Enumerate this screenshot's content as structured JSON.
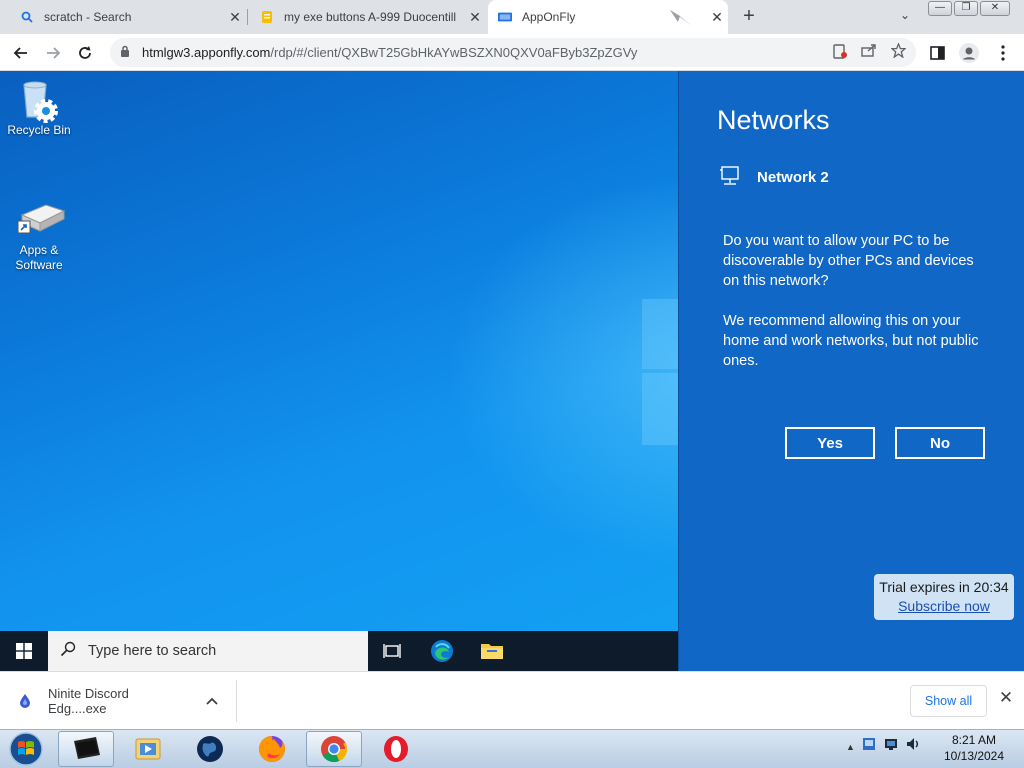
{
  "browser": {
    "tabs": [
      {
        "label": "scratch - Search",
        "icon": "search-icon"
      },
      {
        "label": "my exe buttons A-999 Duocentill",
        "icon": "document-icon"
      },
      {
        "label": "AppOnFly",
        "icon": "apponfly-icon"
      }
    ],
    "url_domain": "htmlgw3.apponfly.com",
    "url_path": "/rdp/#/client/QXBwT25GbHkAYwBSZXN0QXV0aFByb3ZpZGVy"
  },
  "desktop": {
    "icons": [
      {
        "label": "Recycle Bin",
        "icon": "recycle-bin-icon"
      },
      {
        "label": "Apps & Software",
        "icon": "apps-software-icon"
      }
    ]
  },
  "networks_panel": {
    "title": "Networks",
    "network_name": "Network 2",
    "question": "Do you want to allow your PC to be discoverable by other PCs and devices on this network?",
    "recommendation": "We recommend allowing this on your home and work networks, but not public ones.",
    "yes_label": "Yes",
    "no_label": "No"
  },
  "trial": {
    "text": "Trial expires in 20:34",
    "link": "Subscribe now"
  },
  "remote_taskbar": {
    "search_placeholder": "Type here to search"
  },
  "download_bar": {
    "filename": "Ninite Discord Edg....exe",
    "show_all": "Show all"
  },
  "host_taskbar": {
    "time": "8:21 AM",
    "date": "10/13/2024"
  },
  "colors": {
    "panel_blue": "#1067c6",
    "desktop_blue": "#0b79d9",
    "accent_link": "#1a73e8"
  }
}
